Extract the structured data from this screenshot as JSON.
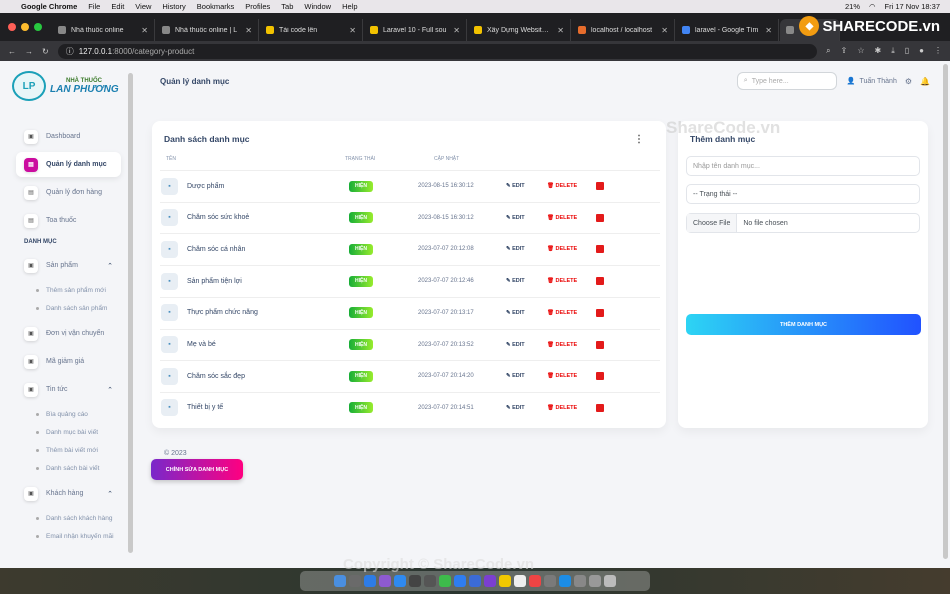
{
  "mac_menu": {
    "app": "Google Chrome",
    "items": [
      "File",
      "Edit",
      "View",
      "History",
      "Bookmarks",
      "Profiles",
      "Tab",
      "Window",
      "Help"
    ],
    "battery": "21%",
    "clock": "Fri 17 Nov 18:37"
  },
  "browser": {
    "tabs": [
      "Nhà thuốc online",
      "Nhà thuốc online | L",
      "Tải code lên",
      "Laravel 10 - Full sou",
      "Xây Dựng Website C",
      "localhost / localhost",
      "laravel - Google Tìm",
      ""
    ],
    "url_host": "127.0.0.1",
    "url_path": ":8000/category-product"
  },
  "brand": {
    "logo_top": "NHÀ THUỐC",
    "logo_main": "LAN PHƯƠNG",
    "watermark": "ShareCode.vn",
    "sharecode": "SHARECODE.vn"
  },
  "sidebar": {
    "items": [
      "Dashboard",
      "Quản lý danh mục",
      "Quản lý đơn hàng",
      "Toa thuốc"
    ],
    "section": "DANH MỤC",
    "products": "Sản phẩm",
    "products_sub": [
      "Thêm sản phẩm mới",
      "Danh sách sản phẩm"
    ],
    "shipping": "Đơn vị vận chuyển",
    "discount": "Mã giảm giá",
    "news": "Tin tức",
    "news_sub": [
      "Bìa quảng cáo",
      "Danh mục bài viết",
      "Thêm bài viết mới",
      "Danh sách bài viết"
    ],
    "customers": "Khách hàng",
    "customers_sub": [
      "Danh sách khách hàng",
      "Email nhận khuyến mãi"
    ]
  },
  "topbar": {
    "title": "Quản lý danh mục",
    "search_placeholder": "Type here...",
    "user": "Tuấn Thành"
  },
  "list": {
    "title": "Danh sách danh mục",
    "col_name": "TÊN",
    "col_status": "TRẠNG THÁI",
    "col_updated": "CẬP NHẬT",
    "rows": [
      {
        "name": "Dược phẩm",
        "status": "HIỆN",
        "date": "2023-08-15 16:30:12",
        "edit": "EDIT",
        "delete": "DELETE"
      },
      {
        "name": "Chăm sóc sức khoẻ",
        "status": "HIỆN",
        "date": "2023-08-15 16:30:12",
        "edit": "EDIT",
        "delete": "DELETE"
      },
      {
        "name": "Chăm sóc cá nhân",
        "status": "HIỆN",
        "date": "2023-07-07 20:12:08",
        "edit": "EDIT",
        "delete": "DELETE"
      },
      {
        "name": "Sản phẩm tiện lợi",
        "status": "HIỆN",
        "date": "2023-07-07 20:12:46",
        "edit": "EDIT",
        "delete": "DELETE"
      },
      {
        "name": "Thực phẩm chức năng",
        "status": "HIỆN",
        "date": "2023-07-07 20:13:17",
        "edit": "EDIT",
        "delete": "DELETE"
      },
      {
        "name": "Mẹ và bé",
        "status": "HIỆN",
        "date": "2023-07-07 20:13:52",
        "edit": "EDIT",
        "delete": "DELETE"
      },
      {
        "name": "Chăm sóc sắc đẹp",
        "status": "HIỆN",
        "date": "2023-07-07 20:14:20",
        "edit": "EDIT",
        "delete": "DELETE"
      },
      {
        "name": "Thiết bị y tế",
        "status": "HIỆN",
        "date": "2023-07-07 20:14:51",
        "edit": "EDIT",
        "delete": "DELETE"
      }
    ]
  },
  "form": {
    "title": "Thêm danh mục",
    "name_placeholder": "Nhập tên danh mục...",
    "status_default": "-- Trạng thái --",
    "file_button": "Choose File",
    "file_none": "No file chosen",
    "submit": "THÊM DANH MỤC"
  },
  "footer": {
    "copyright": "© 2023",
    "edit_button": "CHỈNH SỬA DANH MỤC",
    "copyright_wm": "Copyright © ShareCode.vn"
  },
  "colors": {
    "primary": "#cb0c9f",
    "status_green": "#17ad37",
    "delete_red": "#ea0606",
    "info": "#2152ff"
  }
}
